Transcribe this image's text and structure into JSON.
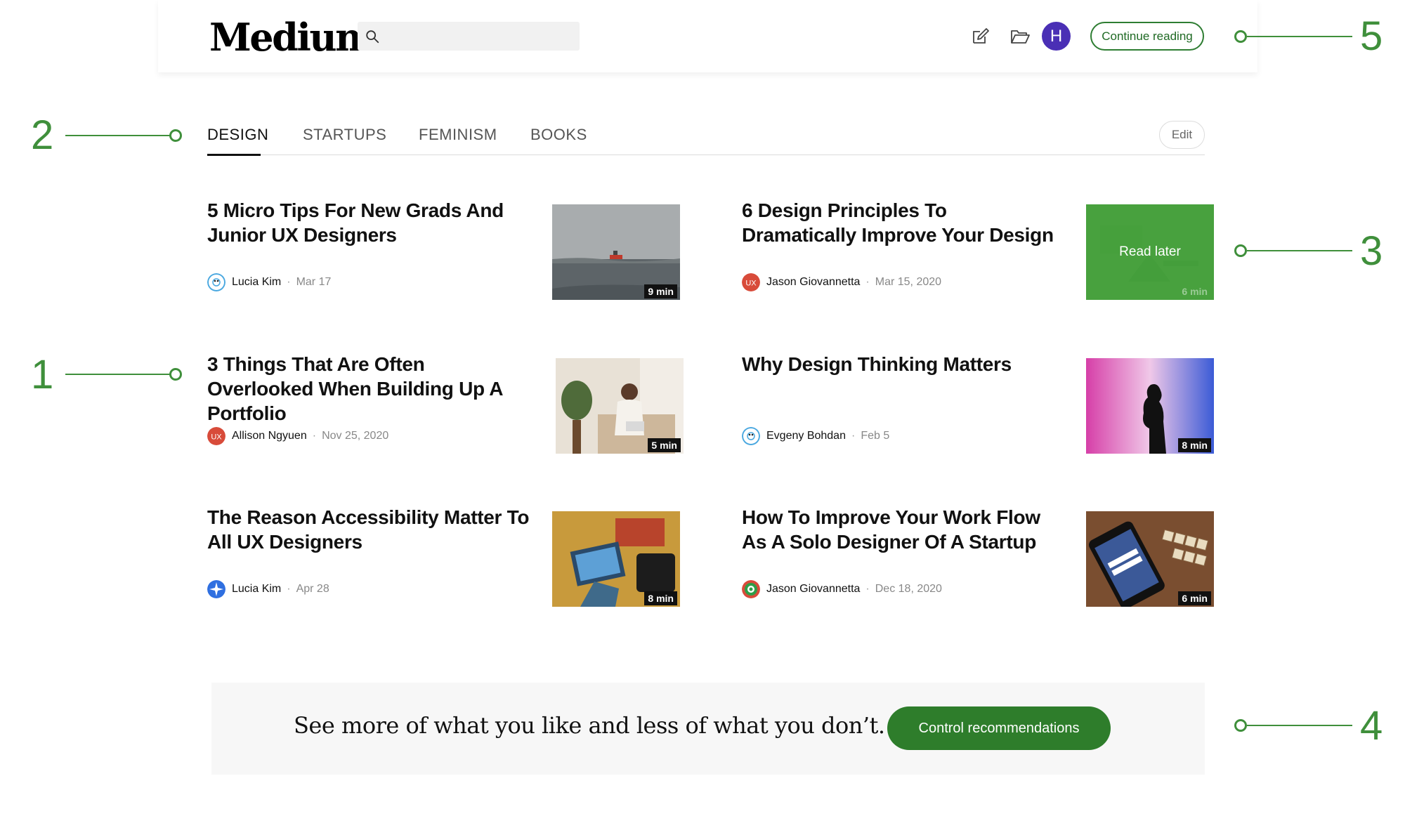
{
  "header": {
    "logo": "Medium",
    "search_placeholder": "",
    "icons": [
      "write-icon",
      "folder-icon"
    ],
    "avatar_initial": "H",
    "continue_label": "Continue reading"
  },
  "annotations": [
    "1",
    "2",
    "3",
    "4",
    "5"
  ],
  "tabs": [
    {
      "label": "DESIGN",
      "active": true
    },
    {
      "label": "STARTUPS",
      "active": false
    },
    {
      "label": "FEMINISM",
      "active": false
    },
    {
      "label": "BOOKS",
      "active": false
    }
  ],
  "edit_label": "Edit",
  "articles": [
    {
      "title": "5 Micro Tips For New Grads And Junior UX Designers",
      "author": "Lucia Kim",
      "date": "Mar 17",
      "read_time": "9 min"
    },
    {
      "title": "6 Design Principles To Dramatically Improve Your Design",
      "author": "Jason Giovannetta",
      "date": "Mar 15, 2020",
      "read_time": "6 min",
      "overlay": "Read later"
    },
    {
      "title": "3 Things That Are Often Overlooked When Building Up A Portfolio",
      "author": "Allison Ngyuen",
      "date": "Nov 25, 2020",
      "read_time": "5 min"
    },
    {
      "title": "Why Design Thinking Matters",
      "author": "Evgeny Bohdan",
      "date": "Feb 5",
      "read_time": "8 min"
    },
    {
      "title": "The Reason Accessibility Matter To All UX Designers",
      "author": "Lucia Kim",
      "date": "Apr 28",
      "read_time": "8 min"
    },
    {
      "title": "How To Improve Your Work Flow As A Solo Designer Of A Startup",
      "author": "Jason Giovannetta",
      "date": "Dec 18, 2020",
      "read_time": "6 min"
    }
  ],
  "cta": {
    "text": "See more of what you like and less of what you don’t.",
    "button": "Control recommendations"
  },
  "colors": {
    "accent": "#2e7d2b",
    "annotation": "#3f8f3b",
    "avatar": "#4a2fb5"
  }
}
